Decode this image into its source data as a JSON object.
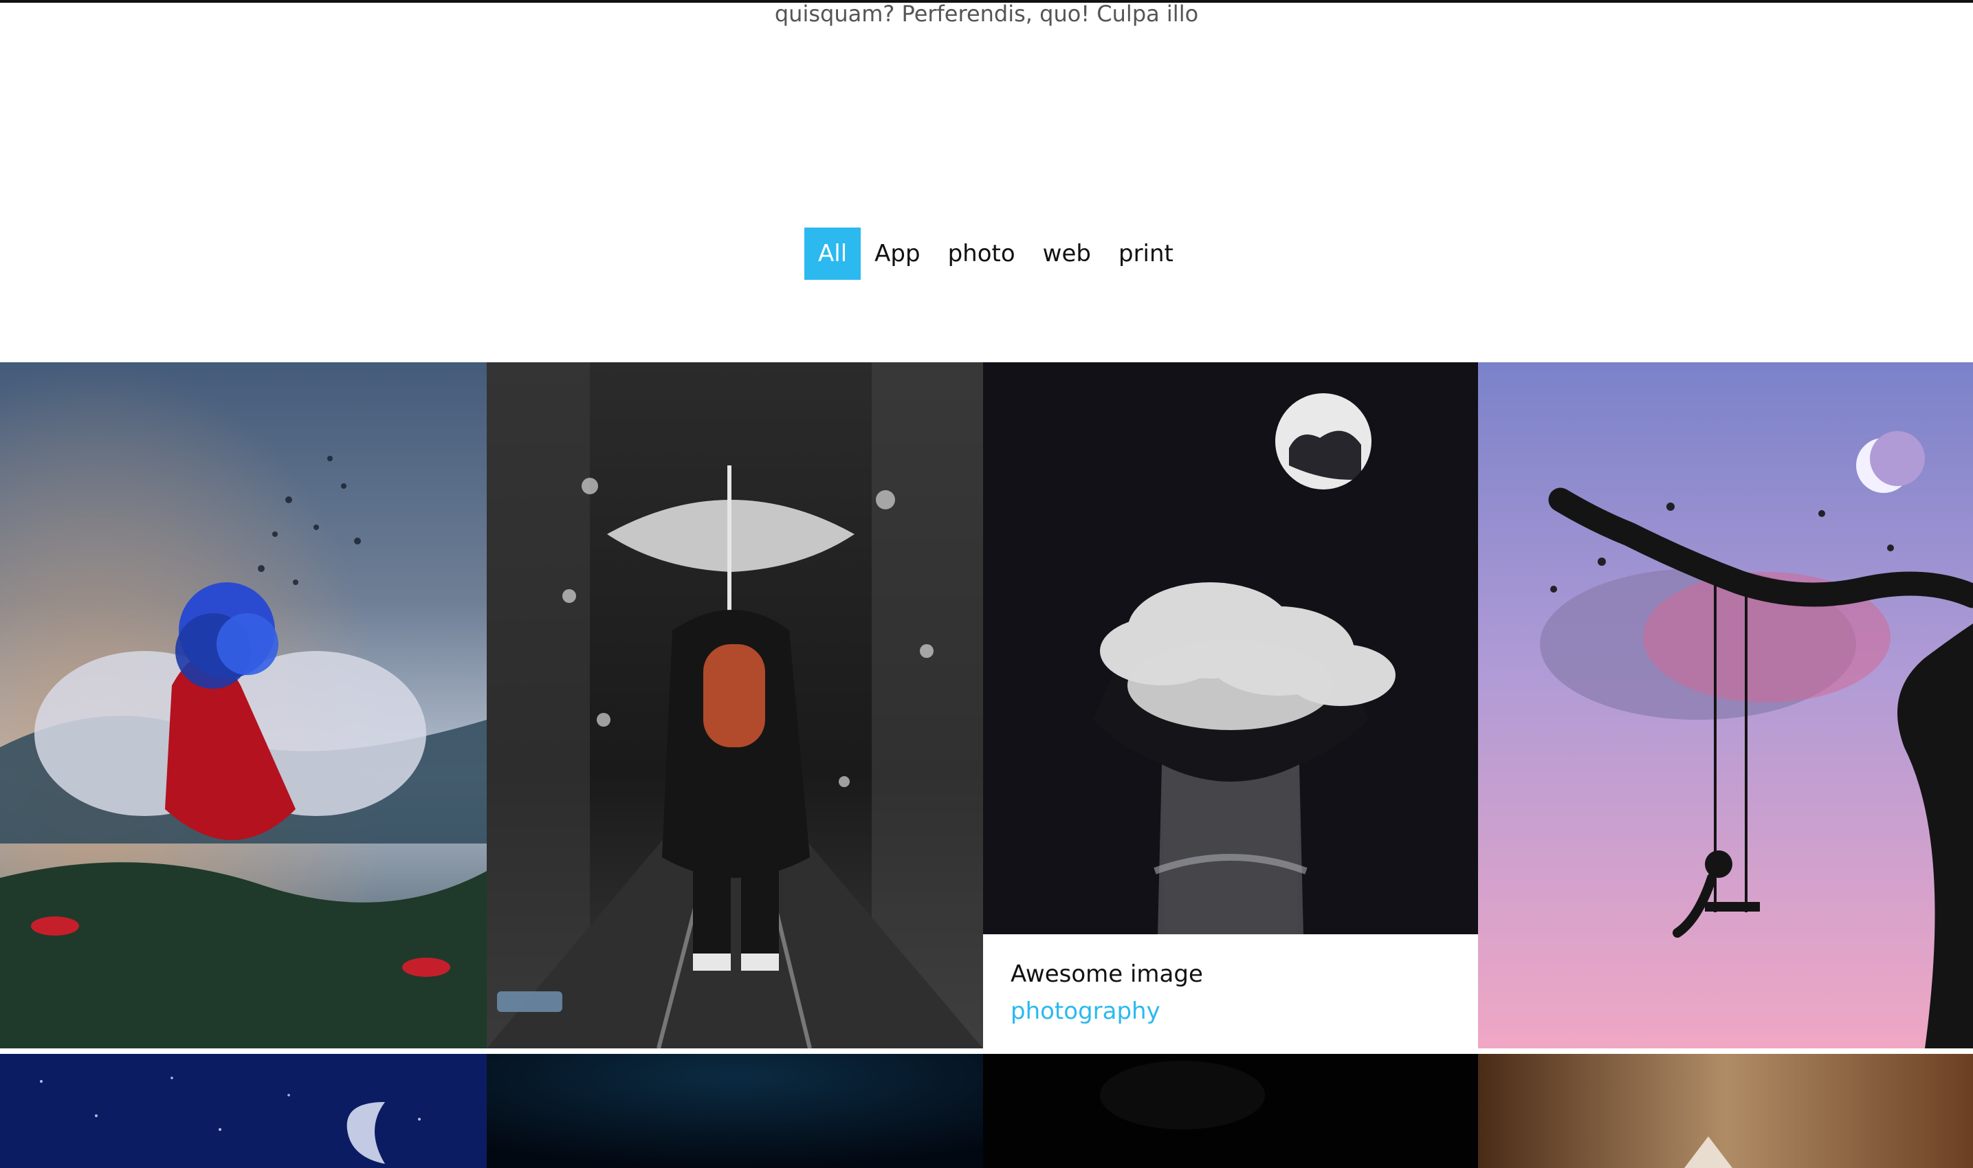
{
  "intro": {
    "text": "quisquam? Perferendis, quo! Culpa illo"
  },
  "filters": [
    {
      "label": "All",
      "active": true
    },
    {
      "label": "App",
      "active": false
    },
    {
      "label": "photo",
      "active": false
    },
    {
      "label": "web",
      "active": false
    },
    {
      "label": "print",
      "active": false
    }
  ],
  "gallery": {
    "items": [
      {
        "name": "fairy-butterfly-image"
      },
      {
        "name": "umbrella-street-image"
      },
      {
        "name": "cloud-head-moon-image",
        "caption_title": "Awesome image",
        "caption_tag": "photography"
      },
      {
        "name": "tree-swing-silhouette-image"
      },
      {
        "name": "starry-moon-image"
      },
      {
        "name": "dark-blue-image"
      },
      {
        "name": "dark-black-image"
      },
      {
        "name": "warm-blur-image"
      }
    ]
  },
  "colors": {
    "accent": "#2bb9f0",
    "text": "#111111"
  }
}
